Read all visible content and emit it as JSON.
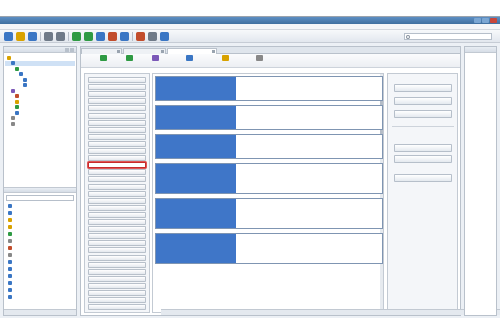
{
  "caption": {
    "text": ""
  },
  "window": {
    "title": "",
    "controls": [
      "minimize",
      "maximize",
      "close"
    ]
  },
  "menu": {
    "items": [
      "",
      "",
      "",
      "",
      "",
      "",
      "",
      ""
    ]
  },
  "toolbar": {
    "icons": [
      "new-icon",
      "open-icon",
      "save-icon",
      "undo-icon",
      "redo-icon",
      "compile-icon",
      "download-icon",
      "online-icon",
      "offline-icon",
      "monitor-icon",
      "stop-icon",
      "settings-icon",
      "help-icon"
    ],
    "search_placeholder": ""
  },
  "project_tree": {
    "header": "",
    "rows": [
      {
        "label": "",
        "indent": 0,
        "icon_color": "#d8a200"
      },
      {
        "label": "",
        "indent": 1,
        "icon_color": "#3a76c4"
      },
      {
        "label": "",
        "indent": 2,
        "icon_color": "#2e9a43"
      },
      {
        "label": "",
        "indent": 3,
        "icon_color": "#3a76c4"
      },
      {
        "label": "",
        "indent": 4,
        "icon_color": "#3a76c4"
      },
      {
        "label": "",
        "indent": 4,
        "icon_color": "#3a76c4"
      },
      {
        "label": "",
        "indent": 1,
        "icon_color": "#7b58b8"
      },
      {
        "label": "",
        "indent": 2,
        "icon_color": "#c24d2c"
      },
      {
        "label": "",
        "indent": 2,
        "icon_color": "#d8a200"
      },
      {
        "label": "",
        "indent": 2,
        "icon_color": "#2e9a43"
      },
      {
        "label": "",
        "indent": 2,
        "icon_color": "#3a76c4"
      },
      {
        "label": "",
        "indent": 1,
        "icon_color": "#888888"
      },
      {
        "label": "",
        "indent": 1,
        "icon_color": "#888888"
      }
    ],
    "lower_header": "",
    "filter_placeholder": "",
    "lower_rows": [
      {
        "label": "",
        "indent": 0,
        "icon_color": "#3a76c4"
      },
      {
        "label": "",
        "indent": 0,
        "icon_color": "#3a76c4"
      },
      {
        "label": "",
        "indent": 0,
        "icon_color": "#d8a200"
      },
      {
        "label": "",
        "indent": 0,
        "icon_color": "#d8a200"
      },
      {
        "label": "",
        "indent": 0,
        "icon_color": "#2e9a43"
      },
      {
        "label": "",
        "indent": 0,
        "icon_color": "#888888"
      },
      {
        "label": "",
        "indent": 0,
        "icon_color": "#c24d2c"
      },
      {
        "label": "",
        "indent": 0,
        "icon_color": "#888888"
      },
      {
        "label": "",
        "indent": 0,
        "icon_color": "#3a76c4"
      },
      {
        "label": "",
        "indent": 0,
        "icon_color": "#3a76c4"
      },
      {
        "label": "",
        "indent": 0,
        "icon_color": "#3a76c4"
      },
      {
        "label": "",
        "indent": 0,
        "icon_color": "#3a76c4"
      },
      {
        "label": "",
        "indent": 0,
        "icon_color": "#3a76c4"
      },
      {
        "label": "",
        "indent": 0,
        "icon_color": "#3a76c4"
      }
    ],
    "status": ""
  },
  "tabs": [
    {
      "label": "",
      "active": false
    },
    {
      "label": "",
      "active": false
    },
    {
      "label": "",
      "active": true
    }
  ],
  "editor_toolbar": [
    {
      "label": "",
      "icon": "apply-icon",
      "color": "#2e9a43"
    },
    {
      "label": "",
      "icon": "transfer-icon",
      "color": "#2e9a43"
    },
    {
      "label": "",
      "icon": "select-icon",
      "color": "#7b58b8"
    },
    {
      "label": "",
      "icon": "checksum-icon",
      "color": "#3a76c4"
    },
    {
      "label": "",
      "icon": "save-close-icon",
      "color": "#d8a200"
    },
    {
      "label": "",
      "icon": "list-icon",
      "color": "#888888"
    }
  ],
  "palette": {
    "items": [
      "",
      "",
      "",
      "",
      "",
      "",
      "",
      "",
      "",
      "",
      "",
      "",
      "",
      "",
      "",
      "",
      "",
      "",
      "",
      "",
      "",
      "",
      "",
      "",
      "",
      "",
      "",
      "",
      "",
      "",
      "",
      "",
      ""
    ],
    "highlighted_index": 12
  },
  "config_elements": [
    {
      "rows": [
        {
          "a": "",
          "b": ""
        },
        {
          "a": "",
          "b": ""
        },
        {
          "a": "",
          "b": ""
        }
      ],
      "extra": [
        ""
      ]
    },
    {
      "rows": [
        {
          "a": "",
          "b": ""
        },
        {
          "a": "",
          "b": ""
        },
        {
          "a": "",
          "b": ""
        }
      ],
      "extra": [
        ""
      ]
    },
    {
      "rows": [
        {
          "a": "",
          "b": ""
        },
        {
          "a": "",
          "b": ""
        },
        {
          "a": "",
          "b": ""
        }
      ],
      "extra": [
        ""
      ]
    },
    {
      "rows": [
        {
          "a": "",
          "b": ""
        },
        {
          "a": "",
          "b": ""
        },
        {
          "a": "",
          "b": ""
        }
      ],
      "extra": [
        "",
        "",
        "",
        ""
      ]
    },
    {
      "rows": [
        {
          "a": "",
          "b": ""
        },
        {
          "a": "",
          "b": ""
        },
        {
          "a": "",
          "b": ""
        }
      ],
      "extra": [
        "",
        "",
        "",
        ""
      ]
    },
    {
      "rows": [
        {
          "a": "",
          "b": ""
        },
        {
          "a": "",
          "b": ""
        },
        {
          "a": "",
          "b": ""
        }
      ],
      "extra": [
        "",
        "",
        "",
        ""
      ]
    }
  ],
  "right_panel": {
    "buttons": [
      "",
      "",
      ""
    ],
    "section": "",
    "subsection": "",
    "sub_buttons": [
      "",
      ""
    ],
    "bottom_button": ""
  },
  "statusbar": {
    "text": ""
  },
  "colors": {
    "accent": "#3f76c8",
    "highlight": "#c62b2b",
    "titlebar": "#3f6f9f"
  }
}
